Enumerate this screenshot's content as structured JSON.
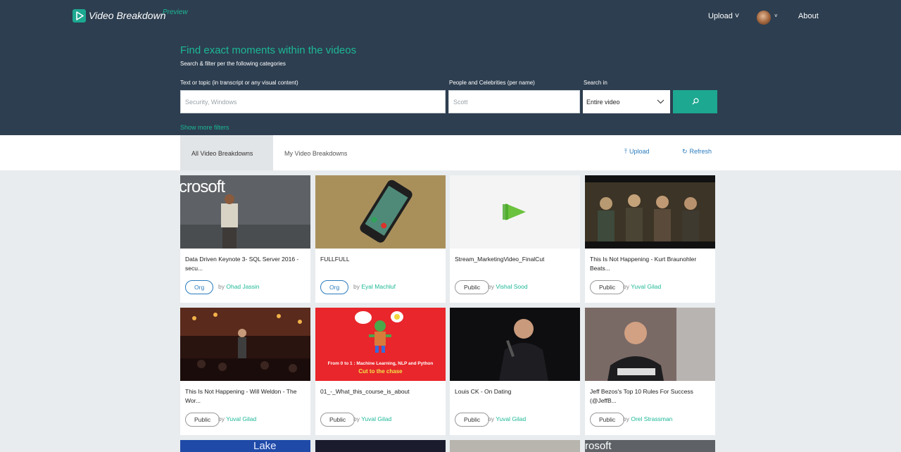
{
  "brand": {
    "name": "Video Breakdown",
    "badge": "Preview",
    "accent": "#1ca891",
    "header_bg": "#2d3e50"
  },
  "nav": {
    "upload": "Upload ˅",
    "about": "About"
  },
  "search": {
    "title": "Find exact moments within the videos",
    "subtitle": "Search & filter per the following categories",
    "text_label": "Text or topic (in transcript or any visual content)",
    "text_placeholder": "Security, Windows",
    "people_label": "People and Celebrities (per name)",
    "people_placeholder": "Scott",
    "searchin_label": "Search in",
    "searchin_value": "Entire video",
    "more_filters": "Show more filters"
  },
  "tabs": {
    "all": "All Video Breakdowns",
    "mine": "My Video Breakdowns"
  },
  "actions": {
    "upload": "Upload",
    "refresh": "Refresh"
  },
  "videos": [
    {
      "title": "Data Driven Keynote 3- SQL Server 2016 - secu...",
      "visibility": "Org",
      "by": "by",
      "author": "Ohad Jassin",
      "thumb": "keynote-stage"
    },
    {
      "title": "FULLFULL",
      "visibility": "Org",
      "by": "by",
      "author": "Eyal Machluf",
      "thumb": "phone-call"
    },
    {
      "title": "Stream_MarketingVideo_FinalCut",
      "visibility": "Public",
      "by": "by",
      "author": "Vishal Sood",
      "thumb": "play-logo"
    },
    {
      "title": "This Is Not Happening - Kurt Braunohler Beats...",
      "visibility": "Public",
      "by": "by",
      "author": "Yuval Gilad",
      "thumb": "movie-cast"
    },
    {
      "title": "This Is Not Happening - Will Weldon - The Wor...",
      "visibility": "Public",
      "by": "by",
      "author": "Yuval Gilad",
      "thumb": "standup-crowd"
    },
    {
      "title": "01_-_What_this_course_is_about",
      "visibility": "Public",
      "by": "by",
      "author": "Yuval Gilad",
      "thumb": "robot-cartoon",
      "thumb_text": [
        "From 0 to 1 : Machine Learning, NLP and Python",
        "Cut to the chase"
      ]
    },
    {
      "title": "Louis CK - On Dating",
      "visibility": "Public",
      "by": "by",
      "author": "Yuval Gilad",
      "thumb": "comedian-mic"
    },
    {
      "title": "Jeff Bezos's Top 10 Rules For Success (@JeffB...",
      "visibility": "Public",
      "by": "by",
      "author": "Orel Strassman",
      "thumb": "speaker-shirt"
    }
  ],
  "thumb_text": {
    "keynote": "crosoft",
    "keynote2": "rosoft",
    "lake": "Lake"
  }
}
